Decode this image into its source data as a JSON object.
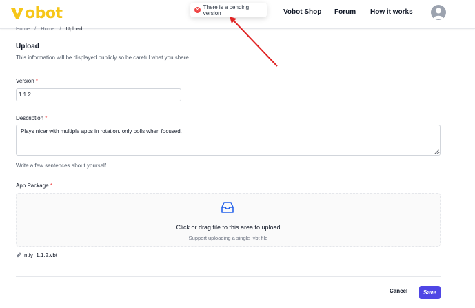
{
  "header": {
    "logo_text": "obot",
    "nav": [
      "Vobot Shop",
      "Forum",
      "How it works"
    ]
  },
  "toast": {
    "message": "There is a pending version",
    "icon": "error-icon"
  },
  "breadcrumb": {
    "items": [
      "Home",
      "Home",
      "Upload"
    ],
    "separator": "/"
  },
  "form": {
    "title": "Upload",
    "description": "This information will be displayed publicly so be careful what you share.",
    "version": {
      "label": "Version",
      "required_mark": "*",
      "value": "1.1.2"
    },
    "desc_field": {
      "label": "Description",
      "required_mark": "*",
      "value": "Plays nicer with multiple apps in rotation. only polls when focused.",
      "help": "Write a few sentences about yourself."
    },
    "package": {
      "label": "App Package",
      "required_mark": "*",
      "drop_main": "Click or drag file to this area to upload",
      "drop_sub": "Support uploading a single .vbt file",
      "file_name": "ntfy_1.1.2.vbt"
    },
    "actions": {
      "cancel": "Cancel",
      "save": "Save"
    }
  },
  "colors": {
    "brand_yellow": "#f6c619",
    "accent": "#4f46e5",
    "error": "#ef4444",
    "annotation_arrow": "#e02424"
  }
}
